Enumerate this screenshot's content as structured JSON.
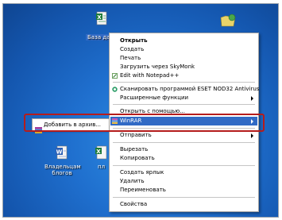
{
  "desktop": {
    "icons": [
      {
        "label": "База да",
        "icon": "excel-file-icon"
      },
      {
        "label": "Владельцам\nблогов",
        "icon": "word-file-icon"
      },
      {
        "label": "пл",
        "icon": "excel-file-icon"
      }
    ]
  },
  "context_menu": {
    "items": [
      {
        "label": "Открыть"
      },
      {
        "label": "Создать"
      },
      {
        "label": "Печать"
      },
      {
        "label": "Загрузить через SkyMonk"
      },
      {
        "label": "Edit with Notepad++"
      },
      {
        "label": "Сканировать программой ESET NOD32 Antivirus"
      },
      {
        "label": "Расширенные функции"
      },
      {
        "label": "Открыть с помощью..."
      },
      {
        "label": "WinRAR"
      },
      {
        "label": "Отправить"
      },
      {
        "label": "Вырезать"
      },
      {
        "label": "Копировать"
      },
      {
        "label": "Создать ярлык"
      },
      {
        "label": "Удалить"
      },
      {
        "label": "Переименовать"
      },
      {
        "label": "Свойства"
      }
    ]
  },
  "winrar_submenu": {
    "items": [
      {
        "label": "Добавить в архив..."
      }
    ]
  },
  "colors": {
    "highlight": "#316ac5",
    "annotation_border": "#b51c1c",
    "desktop": "#1f6fce"
  }
}
